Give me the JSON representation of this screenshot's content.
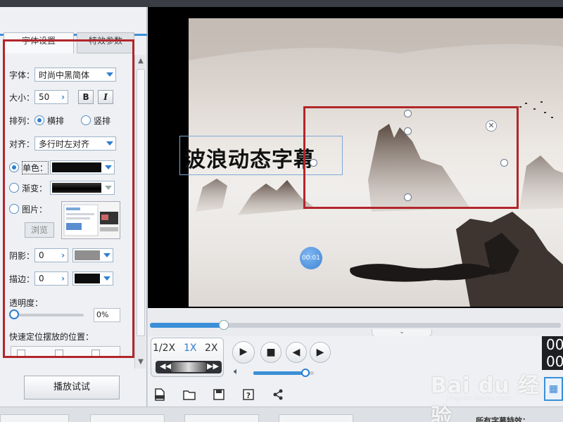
{
  "tabs": [
    {
      "label": "字体设置",
      "active": true
    },
    {
      "label": "特效参数",
      "active": false
    }
  ],
  "font": {
    "label": "字体：",
    "value": "时尚中黑简体"
  },
  "size": {
    "label": "大小：",
    "value": "50",
    "bold_label": "B",
    "italic_label": "I"
  },
  "arrange": {
    "label": "排列：",
    "horizontal": "横排",
    "vertical": "竖排",
    "selected": "横排"
  },
  "align": {
    "label": "对齐：",
    "value": "多行时左对齐"
  },
  "fill": {
    "solid_label": "单色：",
    "solid_color": "#0d0d0d",
    "gradient_label": "渐变：",
    "image_label": "图片：",
    "browse_label": "浏览",
    "selected": "单色"
  },
  "shadow": {
    "label": "阴影：",
    "value": "0",
    "color": "#8f8f8f"
  },
  "stroke": {
    "label": "描边：",
    "value": "0",
    "color": "#0d0d0d"
  },
  "opacity": {
    "label": "透明度：",
    "value": "0%",
    "level": 0
  },
  "quick_position": {
    "label": "快速定位摆放的位置："
  },
  "play_test_label": "播放试试",
  "caption": {
    "text": "波浪动态字幕"
  },
  "time_bubble": "00:01",
  "progress": {
    "level": 0.18
  },
  "speed": {
    "options": [
      "1/2X",
      "1X",
      "2X"
    ],
    "active": "1X"
  },
  "volume": {
    "level": 0.86
  },
  "timecode": [
    "00",
    "00"
  ],
  "bottom": {
    "text": "所有字幕特效："
  },
  "watermark": {
    "brand": "Bai du 经验",
    "url": "jingyan.baidu.com"
  },
  "colors": {
    "accent": "#3b8fd8",
    "frame": "#b2262b"
  },
  "icons": [
    "new-icon",
    "folder-icon",
    "save-icon",
    "help-icon",
    "share-icon",
    "play-icon",
    "stop-icon",
    "prev-frame-icon",
    "next-frame-icon",
    "volume-icon",
    "close-icon",
    "film-icon"
  ]
}
